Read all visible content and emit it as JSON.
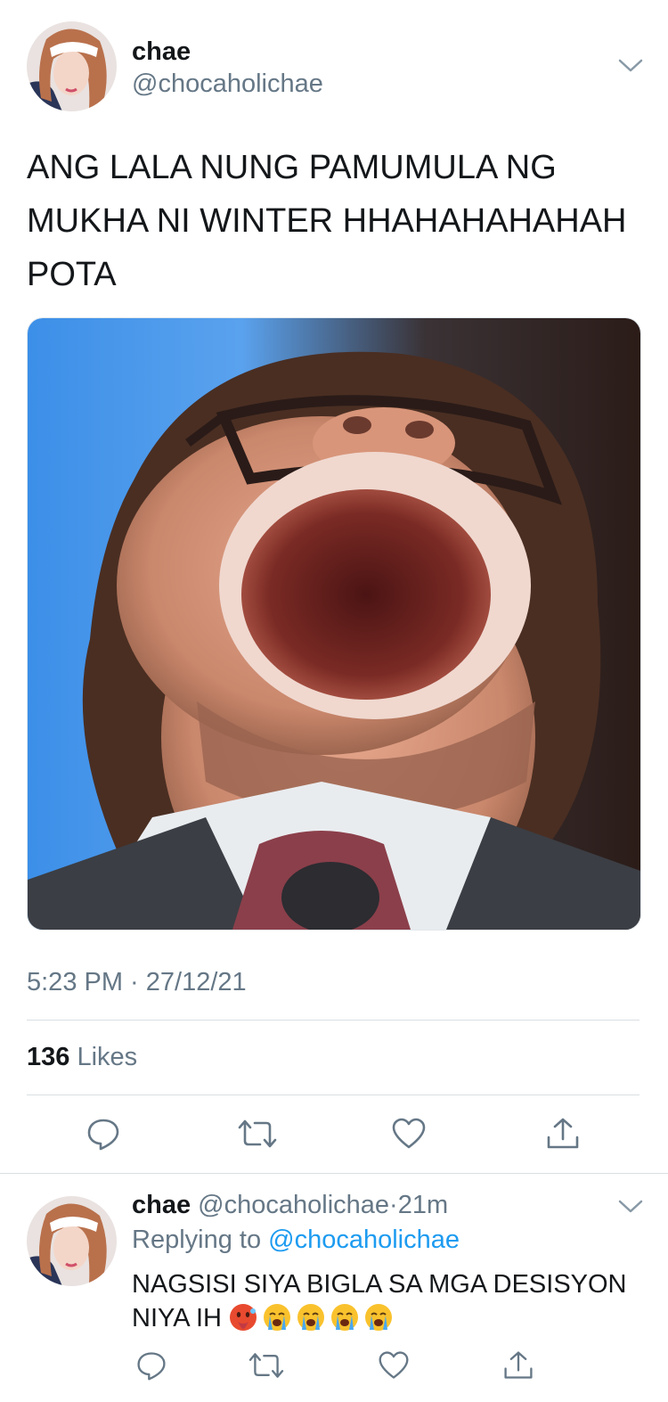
{
  "tweet": {
    "author_name": "chae",
    "author_handle": "@chocaholichae",
    "text": "ANG LALA NUNG PAMUMULA NG MUKHA NI WINTER HHAHAHAHAHAH POTA",
    "timestamp": "5:23 PM · 27/12/21",
    "likes_count": "136",
    "likes_label": "Likes"
  },
  "reply": {
    "author_name": "chae",
    "author_handle": "@chocaholichae",
    "separator": "·",
    "time": "21m",
    "replying_prefix": "Replying to",
    "replying_handle": "@chocaholichae",
    "text": "NAGSISI SIYA BIGLA SA MGA DESISYON NIYA IH",
    "emojis": [
      "hot-face",
      "loudly-crying-face",
      "loudly-crying-face",
      "loudly-crying-face",
      "loudly-crying-face"
    ]
  },
  "icons": [
    "chevron-down-icon",
    "reply-icon",
    "retweet-icon",
    "like-icon",
    "share-icon"
  ],
  "colors": {
    "accent": "#1d9bf0",
    "muted": "#657786",
    "text": "#14171a"
  }
}
